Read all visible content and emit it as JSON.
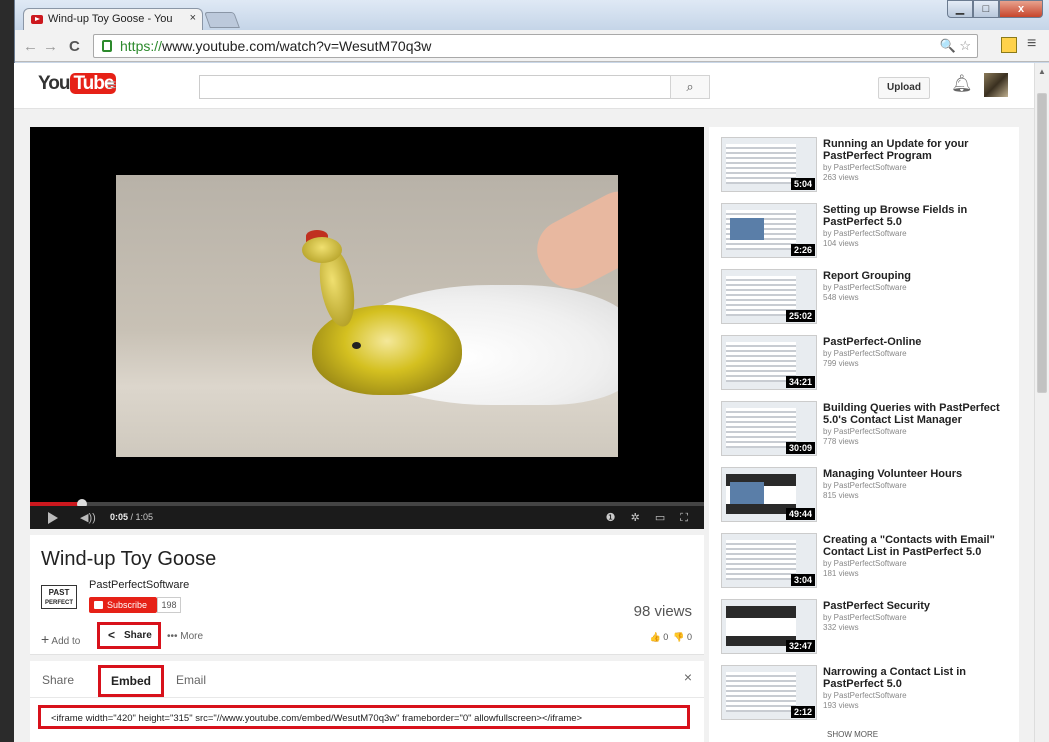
{
  "browser": {
    "tab_title": "Wind-up Toy Goose - You",
    "tab_close": "×",
    "url_scheme": "https://",
    "url_rest": "www.youtube.com/watch?v=WesutM70q3w",
    "back_icon": "←",
    "forward_icon": "→",
    "reload_icon": "C",
    "zoom_icon": "🔍",
    "star_icon": "☆",
    "menu_icon": "≡",
    "win_min": "▁",
    "win_max": "□",
    "win_close": "x"
  },
  "masthead": {
    "logo_you": "You",
    "logo_tube": "Tube",
    "guide_icon": "≡",
    "search_value": "",
    "search_icon": "⌕",
    "upload_label": "Upload",
    "bell_icon": "♫"
  },
  "player": {
    "time_current": "0:05",
    "time_total": "/ 1:05",
    "progress_fraction": 0.077,
    "volume_icon": "◀))",
    "right_icons": "❶ ✲ ▭ ⛶"
  },
  "video": {
    "title": "Wind-up Toy Goose",
    "channel_logo_top": "PAST",
    "channel_logo_bottom": "PERFECT",
    "channel_name": "PastPerfectSoftware",
    "subscribe_label": "Subscribe",
    "subscriber_count": "198",
    "views": "98 views",
    "add_to_icon": "+",
    "add_to_label": "Add to",
    "share_icon": "<",
    "share_label": "Share",
    "more_label": "••• More",
    "likes": "👍 0",
    "dislikes": "👎 0"
  },
  "share_panel": {
    "tab_share": "Share",
    "tab_embed": "Embed",
    "tab_email": "Email",
    "close_icon": "×",
    "embed_code": "<iframe width=\"420\" height=\"315\" src=\"//www.youtube.com/embed/WesutM70q3w\" frameborder=\"0\" allowfullscreen></iframe>"
  },
  "related": [
    {
      "title": "Running an Update for your PastPerfect Program",
      "by": "by PastPerfectSoftware",
      "views": "263 views",
      "duration": "5:04"
    },
    {
      "title": "Setting up Browse Fields in PastPerfect 5.0",
      "by": "by PastPerfectSoftware",
      "views": "104 views",
      "duration": "2:26"
    },
    {
      "title": "Report Grouping",
      "by": "by PastPerfectSoftware",
      "views": "548 views",
      "duration": "25:02"
    },
    {
      "title": "PastPerfect-Online",
      "by": "by PastPerfectSoftware",
      "views": "799 views",
      "duration": "34:21"
    },
    {
      "title": "Building Queries with PastPerfect 5.0's Contact List Manager",
      "by": "by PastPerfectSoftware",
      "views": "778 views",
      "duration": "30:09"
    },
    {
      "title": "Managing Volunteer Hours",
      "by": "by PastPerfectSoftware",
      "views": "815 views",
      "duration": "49:44"
    },
    {
      "title": "Creating a \"Contacts with Email\" Contact List in PastPerfect 5.0",
      "by": "by PastPerfectSoftware",
      "views": "181 views",
      "duration": "3:04"
    },
    {
      "title": "PastPerfect Security",
      "by": "by PastPerfectSoftware",
      "views": "332 views",
      "duration": "32:47"
    },
    {
      "title": "Narrowing a Contact List in PastPerfect 5.0",
      "by": "by PastPerfectSoftware",
      "views": "193 views",
      "duration": "2:12"
    }
  ],
  "sidebar": {
    "show_more": "SHOW MORE"
  },
  "colors": {
    "youtube_red": "#e62117",
    "highlight_red": "#d8111b",
    "https_green": "#2c8a2c"
  }
}
